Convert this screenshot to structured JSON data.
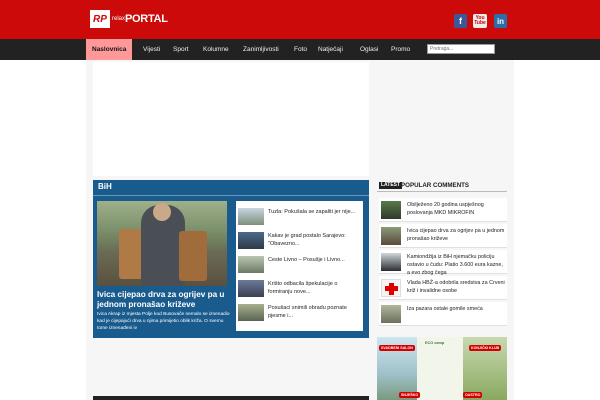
{
  "header": {
    "logo_initials": "RP",
    "logo_small": "relax",
    "logo_big": "PORTAL",
    "social": {
      "facebook": "f",
      "youtube_top": "You",
      "youtube_bottom": "Tube",
      "linkedin": "in"
    }
  },
  "nav": {
    "items": [
      "Naslovnica",
      "Vijesti",
      "Sport",
      "Kolumne",
      "Zanimljivosti",
      "Foto",
      "Natječaji",
      "Oglasi",
      "Promo"
    ],
    "active": "Naslovnica",
    "search_placeholder": "Pretraga..."
  },
  "bih": {
    "title": "BiH",
    "main_headline": "Ivica cijepao drva za ogrijev pa u jednom pronašao križeve",
    "main_text": "Ivica Akrap iz mjesta Polje kod Busovače nemalo se iznenadio kad je cijepajući drva u njima primijetio oblik križa. O svemu tome iznenađeni iv",
    "items": [
      "Tuzla: Pokušala se zapaliti jer nije...",
      "Kakav je grad postalo Sarajevo: \"Obavezno...",
      "Ceste Livno – Posušje i Livno...",
      "Krišto odbacila špekulacije o formiranju nove...",
      "Posušaci snimili obradu poznate pjesme i..."
    ]
  },
  "popular_comments": {
    "tag": "LATEST",
    "title": "POPULAR COMMENTS",
    "items": [
      "Obilježeno 20 godina uspješnog poslovanja MKD MIKROFIN",
      "Ivica cijepao drva za ogrijev pa u jednom pronašao križeve",
      "Kamiondžija iz BiH njemačku policiju ostavio u čudu: Platio 3.600 eura kazne, a evo zbog čega",
      "Vlada HBŽ-a odobrila sredstva za Crveni križ i invalidne osobe",
      "Iza pazara ostale gomile smeća"
    ]
  },
  "banner": {
    "tag_top_left": "SVADBENI SALON",
    "tag_top_right": "KONJIČKI KLUB",
    "tag_bottom_left": "SNJEŠKO",
    "tag_bottom_right": "OASTRO",
    "eco_logo": "ECO camp"
  },
  "colors": {
    "header_red": "#cc0a0a",
    "nav_dark": "#222222",
    "nav_active": "#ff9999",
    "bih_blue": "#1a5b8e"
  }
}
